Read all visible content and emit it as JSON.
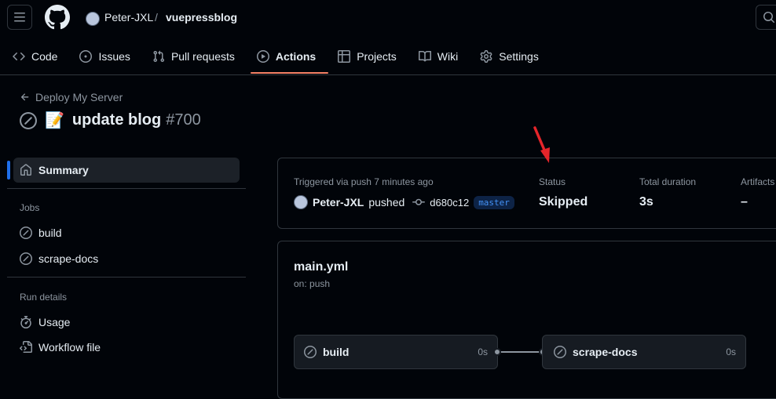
{
  "header": {
    "owner": "Peter-JXL",
    "separator": "/",
    "repo": "vuepressblog"
  },
  "tabs": [
    {
      "label": "Code",
      "icon": "code-icon"
    },
    {
      "label": "Issues",
      "icon": "issue-icon"
    },
    {
      "label": "Pull requests",
      "icon": "pull-request-icon"
    },
    {
      "label": "Actions",
      "icon": "play-icon",
      "active": true
    },
    {
      "label": "Projects",
      "icon": "table-icon"
    },
    {
      "label": "Wiki",
      "icon": "book-icon"
    },
    {
      "label": "Settings",
      "icon": "gear-icon"
    }
  ],
  "run": {
    "back_label": "Deploy My Server",
    "emoji": "📝",
    "title": "update blog",
    "number": "#700"
  },
  "sidebar": {
    "summary": "Summary",
    "jobs_heading": "Jobs",
    "jobs": [
      "build",
      "scrape-docs"
    ],
    "details_heading": "Run details",
    "details": [
      "Usage",
      "Workflow file"
    ]
  },
  "summary": {
    "trigger_text": "Triggered via push 7 minutes ago",
    "actor": "Peter-JXL",
    "action": "pushed",
    "commit": "d680c12",
    "branch": "master",
    "status_label": "Status",
    "status_value": "Skipped",
    "duration_label": "Total duration",
    "duration_value": "3s",
    "artifacts_label": "Artifacts",
    "artifacts_value": "–"
  },
  "workflow": {
    "file": "main.yml",
    "trigger": "on: push",
    "jobs": [
      {
        "name": "build",
        "duration": "0s"
      },
      {
        "name": "scrape-docs",
        "duration": "0s"
      }
    ]
  },
  "colors": {
    "accent": "#f78166",
    "link": "#4493f8",
    "annotation_arrow": "#e5252a"
  }
}
